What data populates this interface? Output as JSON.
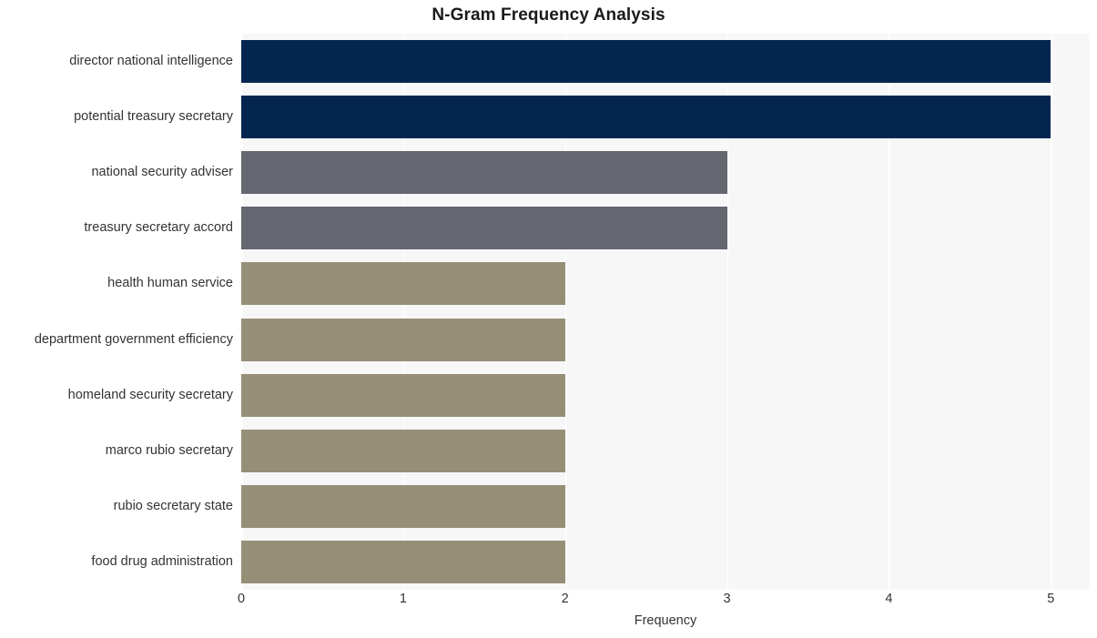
{
  "chart_data": {
    "type": "bar",
    "orientation": "horizontal",
    "title": "N-Gram Frequency Analysis",
    "xlabel": "Frequency",
    "ylabel": "",
    "categories": [
      "director national intelligence",
      "potential treasury secretary",
      "national security adviser",
      "treasury secretary accord",
      "health human service",
      "department government efficiency",
      "homeland security secretary",
      "marco rubio secretary",
      "rubio secretary state",
      "food drug administration"
    ],
    "values": [
      5,
      5,
      3,
      3,
      2,
      2,
      2,
      2,
      2,
      2
    ],
    "bar_colors": [
      "#04254f",
      "#04254f",
      "#646670",
      "#646670",
      "#968f77",
      "#968f77",
      "#968f77",
      "#968f77",
      "#968f77",
      "#968f77"
    ],
    "xlim": [
      0,
      5.24
    ],
    "x_ticks": [
      0,
      1,
      2,
      3,
      4,
      5
    ],
    "x_tick_labels": [
      "0",
      "1",
      "2",
      "3",
      "4",
      "5"
    ],
    "grid": true,
    "grid_axis": "x",
    "grid_color": "#ffffff",
    "plot_background": "#f7f7f8",
    "figure_background": "#ffffff",
    "legend": null,
    "legend_position": "none"
  }
}
